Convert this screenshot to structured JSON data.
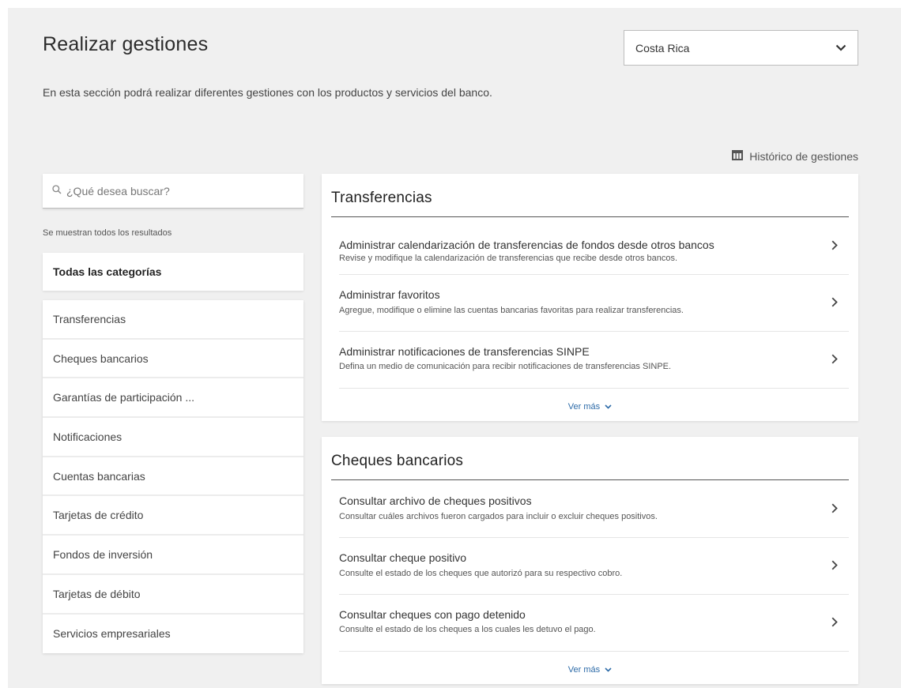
{
  "header": {
    "title": "Realizar gestiones",
    "description": "En esta sección podrá realizar diferentes gestiones con los productos y servicios del banco.",
    "country_selected": "Costa Rica",
    "history_link": "Histórico de gestiones"
  },
  "sidebar": {
    "search_placeholder": "¿Qué desea buscar?",
    "results_note": "Se muestran todos los resultados",
    "all_categories": "Todas las categorías",
    "categories": [
      "Transferencias",
      "Cheques bancarios",
      "Garantías de participación ...",
      "Notificaciones",
      "Cuentas bancarias",
      "Tarjetas de crédito",
      "Fondos de inversión",
      "Tarjetas de débito",
      "Servicios empresariales"
    ]
  },
  "sections": [
    {
      "title": "Transferencias",
      "items": [
        {
          "title": "Administrar calendarización de transferencias de fondos desde otros bancos",
          "desc": "Revise y modifique la calendarización de transferencias que recibe desde otros bancos."
        },
        {
          "title": "Administrar favoritos",
          "desc": "Agregue, modifique o elimine las cuentas bancarias favoritas para realizar transferencias."
        },
        {
          "title": "Administrar notificaciones de transferencias SINPE",
          "desc": "Defina un medio de comunicación para recibir notificaciones de transferencias SINPE."
        }
      ],
      "more": "Ver más"
    },
    {
      "title": "Cheques bancarios",
      "items": [
        {
          "title": "Consultar archivo de cheques positivos",
          "desc": "Consultar cuáles archivos fueron cargados para incluir o excluir cheques positivos."
        },
        {
          "title": "Consultar cheque positivo",
          "desc": "Consulte el estado de los cheques que autorizó para su respectivo cobro."
        },
        {
          "title": "Consultar cheques con pago detenido",
          "desc": "Consulte el estado de los cheques a los cuales les detuvo el pago."
        }
      ],
      "more": "Ver más"
    }
  ],
  "colors": {
    "page_bg": "#f0f0f0",
    "card_bg": "#ffffff",
    "link": "#2d6ba8"
  },
  "icons": {
    "select": "chevron-down-icon",
    "history": "table-icon",
    "search": "search-icon",
    "row": "chevron-right-icon"
  }
}
